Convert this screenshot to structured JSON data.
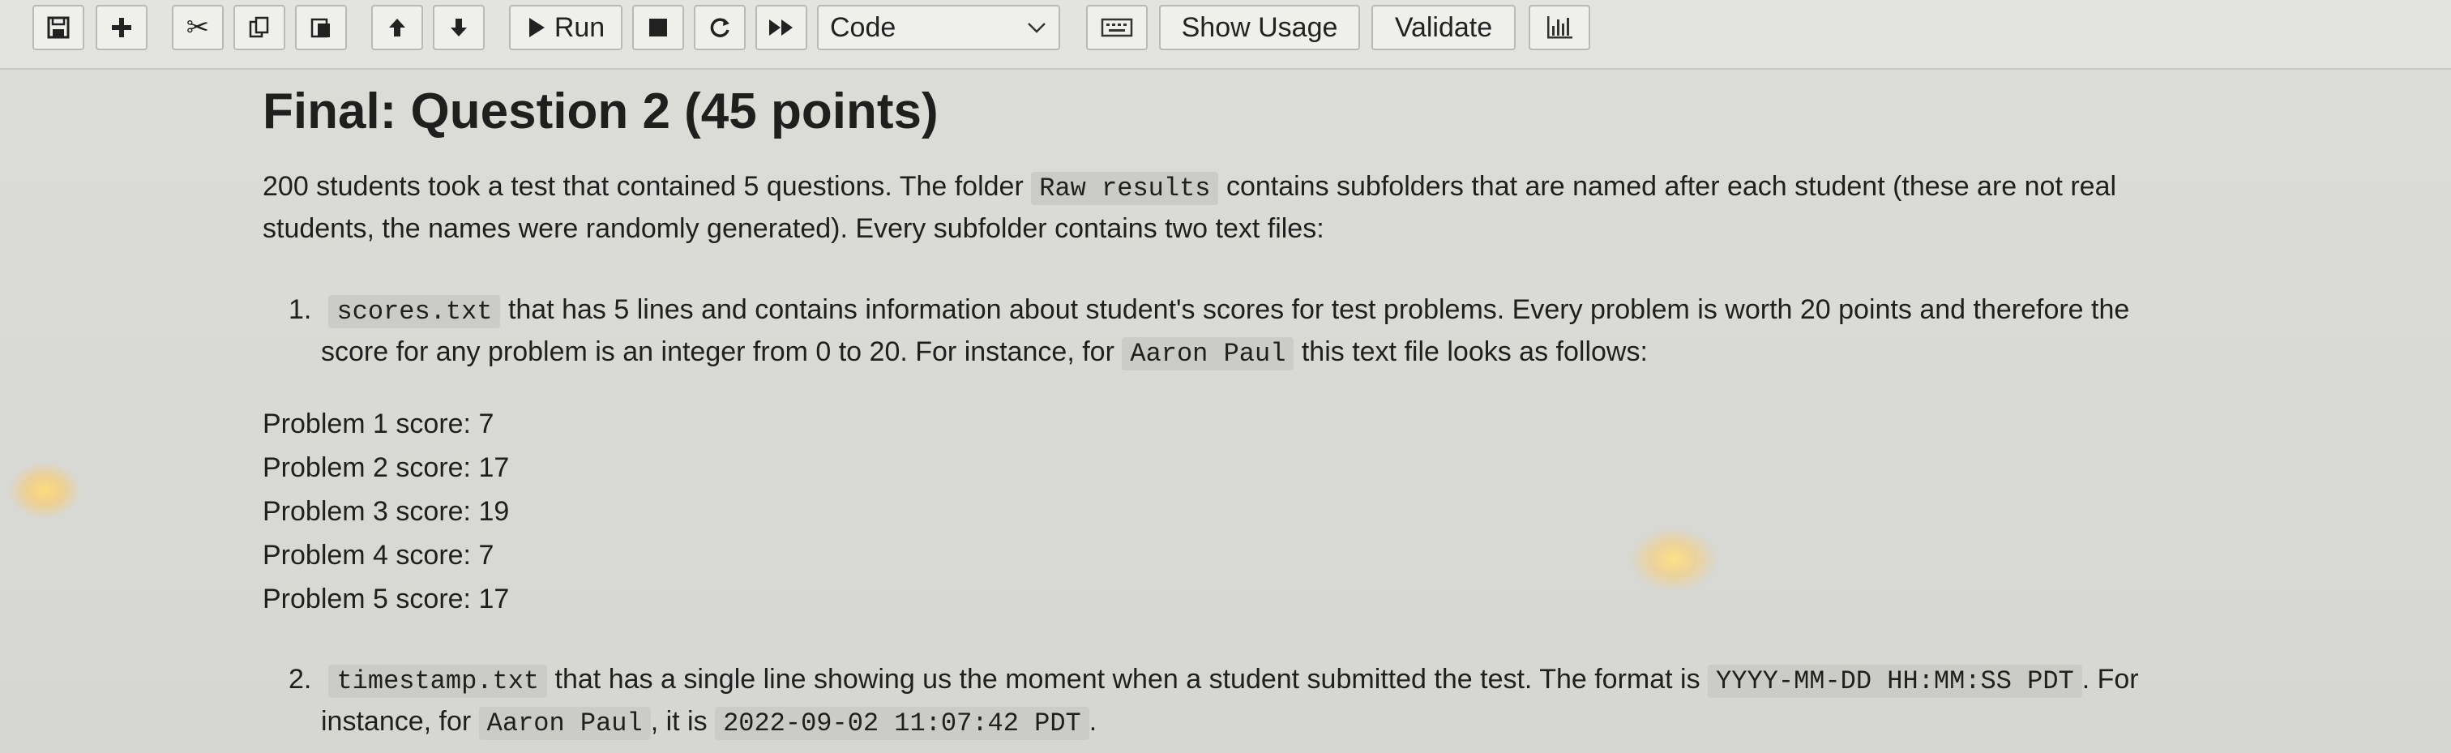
{
  "toolbar": {
    "save_icon": "save-icon",
    "add_icon": "plus-icon",
    "cut_icon": "scissors-icon",
    "copy_icon": "copy-icon",
    "paste_icon": "paste-icon",
    "move_up_icon": "arrow-up-icon",
    "move_down_icon": "arrow-down-icon",
    "run_label": "Run",
    "stop_icon": "stop-icon",
    "restart_icon": "restart-icon",
    "fast_forward_icon": "fast-forward-icon",
    "cell_type_value": "Code",
    "keyboard_icon": "keyboard-icon",
    "show_usage_label": "Show Usage",
    "validate_label": "Validate",
    "chart_icon": "bar-chart-icon"
  },
  "notebook": {
    "title": "Final: Question 2 (45 points)",
    "intro": {
      "text1": "200 students took a test that contained 5 questions. The folder",
      "code1": "Raw results",
      "text2": "contains subfolders that are named after each student (these are not real",
      "line2": "students, the names were randomly generated). Every subfolder contains two text files:"
    },
    "item1": {
      "number": "1.",
      "code1": "scores.txt",
      "text1": "that has 5 lines and contains information about student's scores for test problems. Every problem is worth 20 points and therefore the",
      "text2": "score for any problem is an integer from 0 to 20. For instance, for",
      "code2": "Aaron Paul",
      "text3": "this text file looks as follows:"
    },
    "scores": [
      "Problem 1 score: 7",
      "Problem 2 score: 17",
      "Problem 3 score: 19",
      "Problem 4 score: 7",
      "Problem 5 score: 17"
    ],
    "item2": {
      "number": "2.",
      "code1": "timestamp.txt",
      "text1": "that has a single line showing us the moment when a student submitted the test. The format is",
      "code2": "YYYY-MM-DD HH:MM:SS PDT",
      "text2": ". For",
      "text3": "instance, for",
      "code3": "Aaron Paul",
      "text4": ", it is",
      "code4": "2022-09-02 11:07:42 PDT",
      "text5": "."
    }
  }
}
